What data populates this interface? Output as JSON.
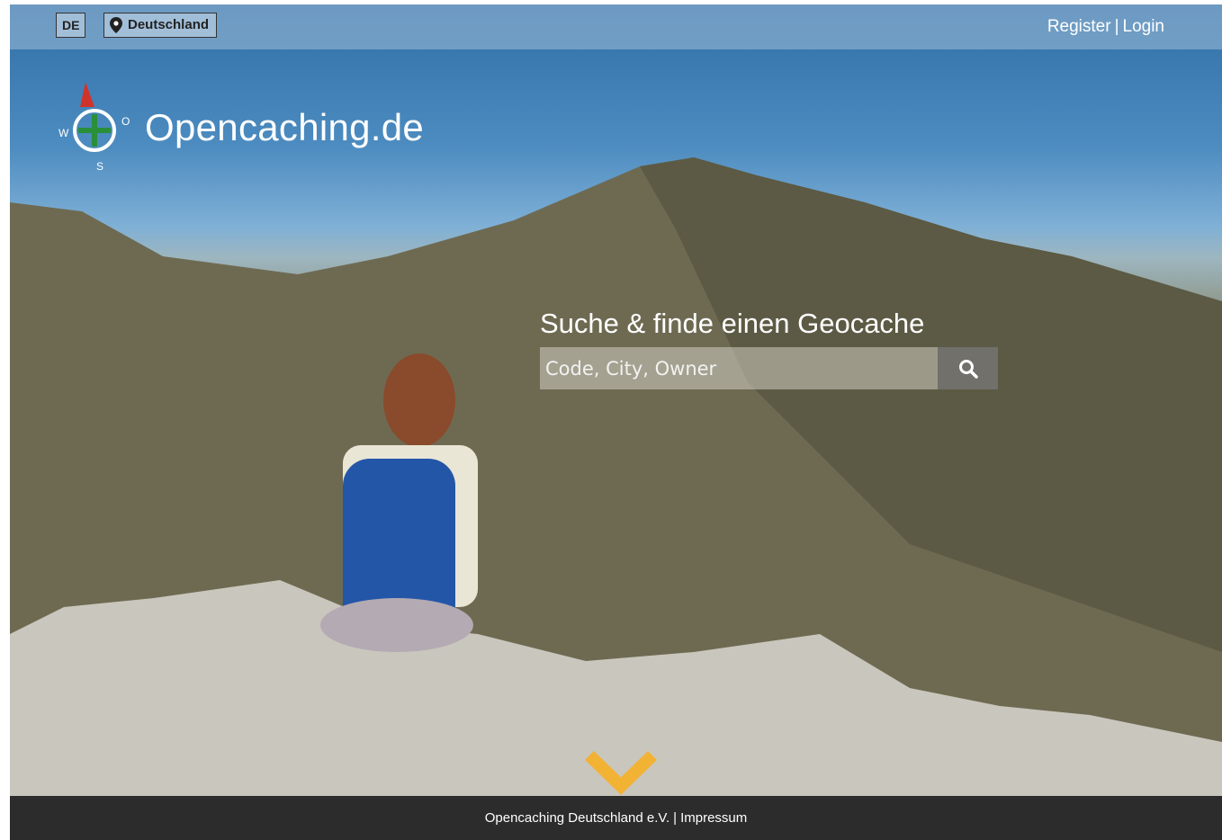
{
  "header": {
    "language_label": "DE",
    "country_label": "Deutschland",
    "register_label": "Register",
    "separator": "|",
    "login_label": "Login"
  },
  "logo": {
    "text": "Opencaching.de"
  },
  "hero": {
    "headline": "Suche & finde einen Geocache",
    "search_placeholder": "Code, City, Owner"
  },
  "footer": {
    "org_label": "Opencaching Deutschland e.V.",
    "separator": "|",
    "impressum_label": "Impressum"
  },
  "icons": {
    "location": "map-pin-icon",
    "search": "magnifier-icon",
    "scroll": "chevron-down-icon",
    "logo": "compass-icon"
  },
  "colors": {
    "footer_bg": "#2c2c2c",
    "chevron": "#f2b234"
  }
}
